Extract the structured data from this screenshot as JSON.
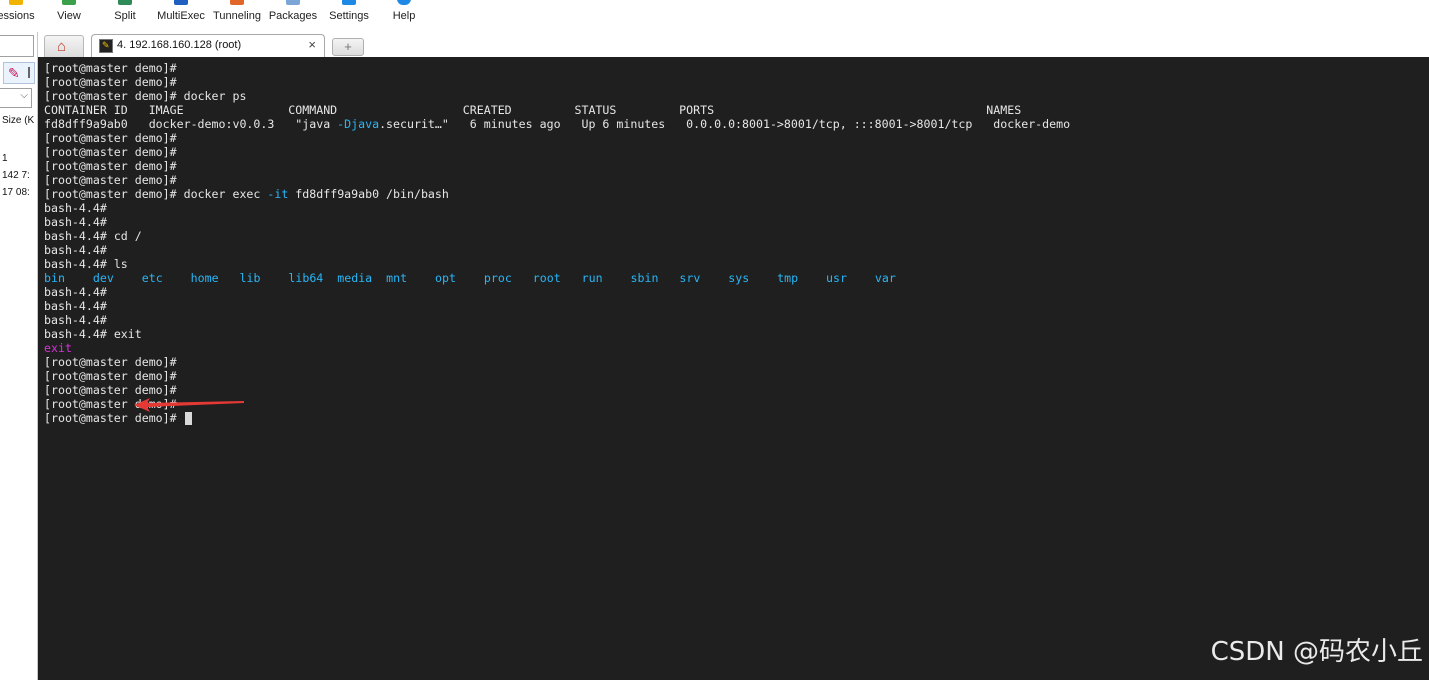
{
  "toolbar": {
    "items": [
      {
        "label": "essions",
        "icon": "star-icon",
        "color": "#f0b400"
      },
      {
        "label": "View",
        "icon": "view-icon",
        "color": "#3aa04a"
      },
      {
        "label": "Split",
        "icon": "split-icon",
        "color": "#2e8b57"
      },
      {
        "label": "MultiExec",
        "icon": "multiexec-icon",
        "color": "#1f5fbf"
      },
      {
        "label": "Tunneling",
        "icon": "tunneling-icon",
        "color": "#e0662a"
      },
      {
        "label": "Packages",
        "icon": "packages-icon",
        "color": "#7aa5d6"
      },
      {
        "label": "Settings",
        "icon": "settings-icon",
        "color": "#1e88e5"
      },
      {
        "label": "Help",
        "icon": "help-icon",
        "color": "#1e88e5"
      }
    ]
  },
  "sidebar": {
    "size_label": "Size (K",
    "rows": [
      "1",
      "142 7:",
      "17 08:"
    ]
  },
  "tabs": {
    "home_icon": "home-icon",
    "active_label": "4. 192.168.160.128 (root)",
    "close_glyph": "×",
    "new_glyph": "+"
  },
  "terminal": {
    "prompt": "[root@master demo]#",
    "bash_prompt": "bash-4.4#",
    "cmd_docker_ps": "docker ps",
    "ps_header": "CONTAINER ID   IMAGE               COMMAND                  CREATED         STATUS         PORTS                                       NAMES",
    "ps_row_pre": "fd8dff9a9ab0   docker-demo:v0.0.3   \"java ",
    "ps_row_flag": "-Djava",
    "ps_row_post": ".securit…\"   6 minutes ago   Up 6 minutes   0.0.0.0:8001->8001/tcp, :::8001->8001/tcp   docker-demo",
    "exec_cmd_pre": "docker exec ",
    "exec_cmd_flag": "-it",
    "exec_cmd_post": " fd8dff9a9ab0 /bin/bash",
    "cmd_cd": "cd /",
    "cmd_ls": "ls",
    "ls_output": [
      "bin",
      "dev",
      "etc",
      "home",
      "lib",
      "lib64",
      "media",
      "mnt",
      "opt",
      "proc",
      "root",
      "run",
      "sbin",
      "srv",
      "sys",
      "tmp",
      "usr",
      "var"
    ],
    "cmd_exit": "exit",
    "exit_echo": "exit"
  },
  "watermark": "CSDN @码农小丘",
  "colors": {
    "terminal_bg": "#1f1f1f",
    "ls_dir": "#29b6f6",
    "exit_echo": "#d633d6",
    "arrow": "#e53935"
  }
}
